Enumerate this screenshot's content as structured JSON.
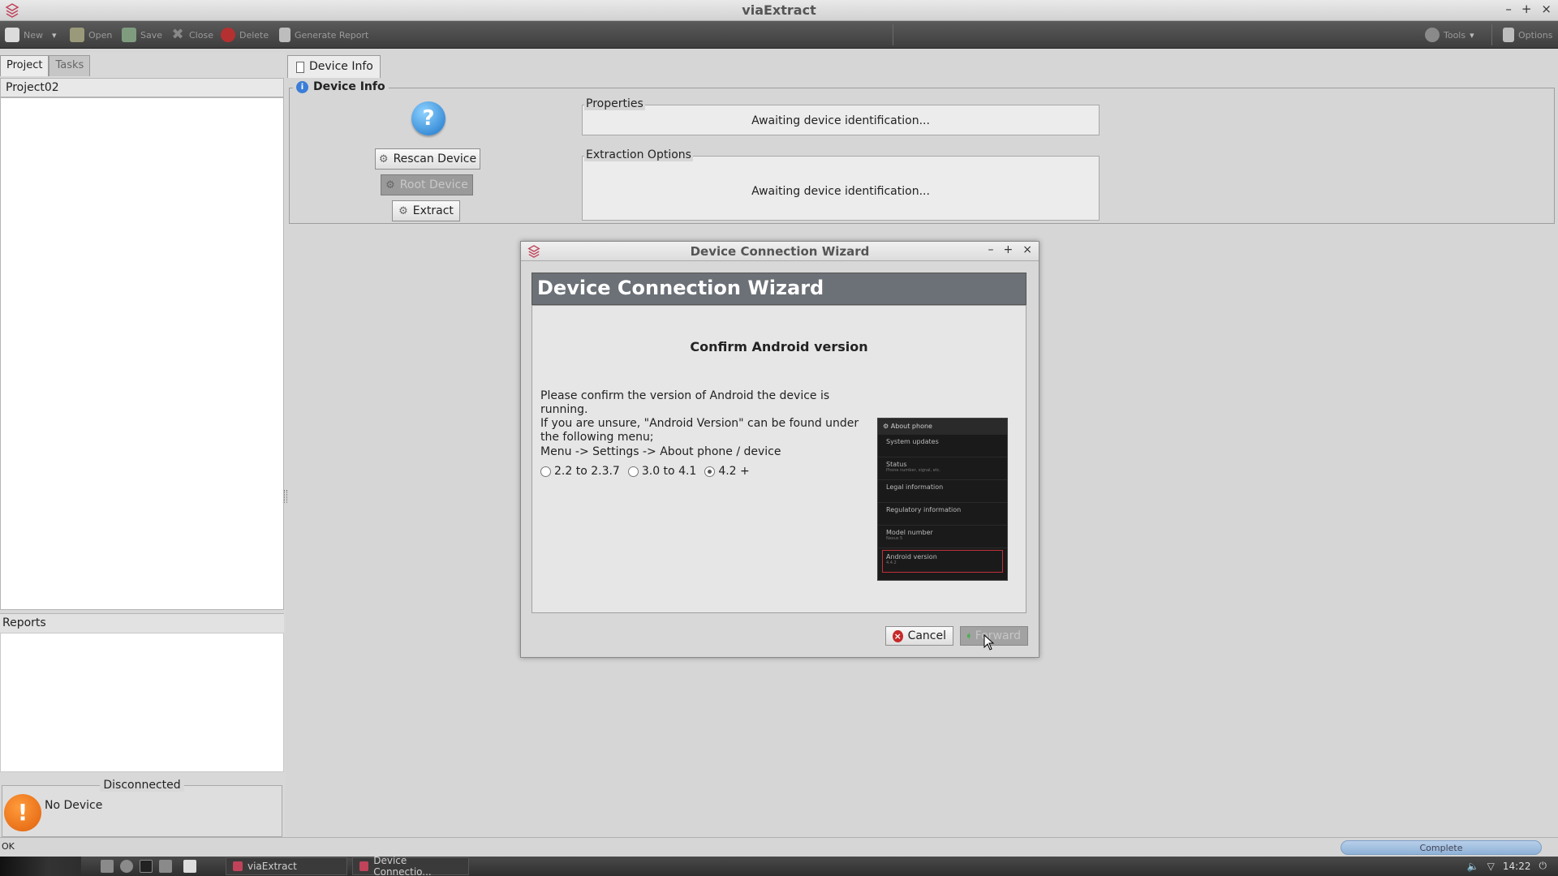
{
  "window": {
    "title": "viaExtract",
    "minimize": "–",
    "maximize": "+",
    "close": "×"
  },
  "toolbar": {
    "items": [
      {
        "label": "New"
      },
      {
        "label": "Open"
      },
      {
        "label": "Save"
      },
      {
        "label": "Close"
      },
      {
        "label": "Delete"
      },
      {
        "label": "Generate Report"
      }
    ],
    "tools": {
      "label": "Tools"
    },
    "options": {
      "label": "Options"
    }
  },
  "left": {
    "tabs": [
      {
        "label": "Project",
        "active": true
      },
      {
        "label": "Tasks",
        "active": false
      }
    ],
    "project_name": "Project02",
    "reports_label": "Reports",
    "connection": {
      "status": "Disconnected",
      "device": "No Device",
      "icon": "warning-icon"
    }
  },
  "main": {
    "tab_label": "Device Info",
    "panel_title": "Device Info",
    "buttons": {
      "rescan": "Rescan Device",
      "root": "Root Device",
      "extract": "Extract"
    },
    "properties": {
      "label": "Properties",
      "value": "Awaiting device identification..."
    },
    "extraction": {
      "label": "Extraction Options",
      "value": "Awaiting device identification..."
    }
  },
  "dialog": {
    "title": "Device Connection Wizard",
    "minimize": "–",
    "maximize": "+",
    "close": "×",
    "header": "Device Connection Wizard",
    "heading": "Confirm Android version",
    "paragraph": "Please confirm the version of Android the device is running.\n If you are unsure, \"Android Version\" can be found under\nthe following menu;",
    "menu_path": "Menu -> Settings -> About phone / device",
    "options": [
      {
        "label": "2.2 to 2.3.7",
        "checked": false
      },
      {
        "label": "3.0 to 4.1",
        "checked": false
      },
      {
        "label": "4.2 +",
        "checked": true
      }
    ],
    "phone_screenshot": {
      "header": "About phone",
      "items": [
        {
          "title": "System updates",
          "sub": ""
        },
        {
          "title": "Status",
          "sub": "Phone number, signal, etc."
        },
        {
          "title": "Legal information",
          "sub": ""
        },
        {
          "title": "Regulatory information",
          "sub": ""
        },
        {
          "title": "Model number",
          "sub": "Nexus 5"
        },
        {
          "title": "Android version",
          "sub": "4.4.2"
        }
      ]
    },
    "cancel_label": "Cancel",
    "forward_label": "Forward"
  },
  "statusbar": {
    "text": "OK",
    "progress_label": "Complete"
  },
  "taskbar": {
    "tasks": [
      {
        "label": "viaExtract"
      },
      {
        "label": "Device Connectio..."
      }
    ],
    "clock": "14:22"
  },
  "colors": {
    "accent_wizard_header": "#6b7176",
    "warning": "#e0600c",
    "help": "#1a74c9"
  }
}
